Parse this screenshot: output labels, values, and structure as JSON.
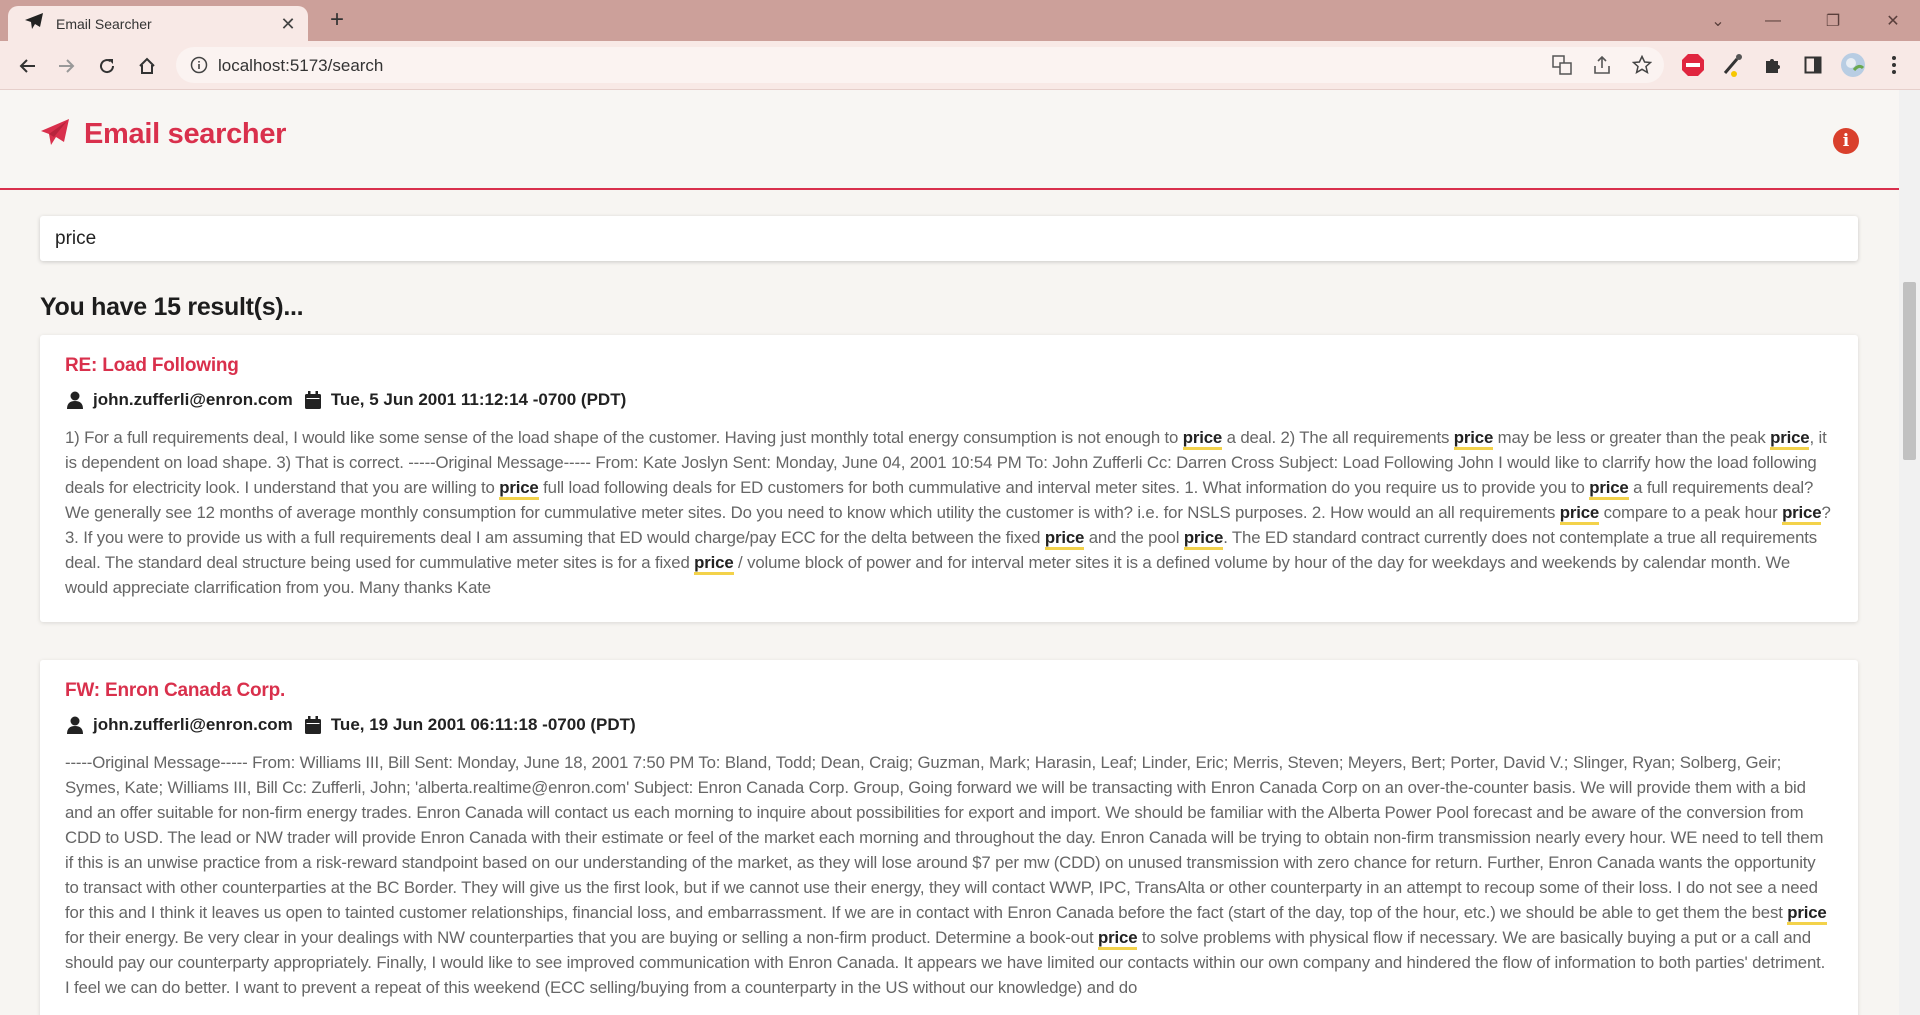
{
  "browser": {
    "tab_title": "Email Searcher",
    "url": "localhost:5173/search"
  },
  "app": {
    "title": "Email searcher",
    "info_label": "i"
  },
  "search": {
    "value": "price"
  },
  "results_heading": "You have 15 result(s)...",
  "results": [
    {
      "subject": "RE: Load Following",
      "from": "john.zufferli@enron.com",
      "date": "Tue, 5 Jun 2001 11:12:14 -0700 (PDT)",
      "body": "1) For a full requirements deal, I would like some sense of the load shape of the customer. Having just monthly total energy consumption is not enough to price a deal. 2) The all requirements price may be less or greater than the peak price, it is dependent on load shape. 3) That is correct. -----Original Message----- From: Kate Joslyn Sent: Monday, June 04, 2001 10:54 PM To: John Zufferli Cc: Darren Cross Subject: Load Following John I would like to clarrify how the load following deals for electricity look. I understand that you are willing to price full load following deals for ED customers for both cummulative and interval meter sites. 1. What information do you require us to provide you to price a full requirements deal? We generally see 12 months of average monthly consumption for cummulative meter sites. Do you need to know which utility the customer is with? i.e. for NSLS purposes. 2. How would an all requirements price compare to a peak hour price? 3. If you were to provide us with a full requirements deal I am assuming that ED would charge/pay ECC for the delta between the fixed price and the pool price. The ED standard contract currently does not contemplate a true all requirements deal. The standard deal structure being used for cummulative meter sites is for a fixed price / volume block of power and for interval meter sites it is a defined volume by hour of the day for weekdays and weekends by calendar month. We would appreciate clarrification from you. Many thanks Kate"
    },
    {
      "subject": "FW: Enron Canada Corp.",
      "from": "john.zufferli@enron.com",
      "date": "Tue, 19 Jun 2001 06:11:18 -0700 (PDT)",
      "body": "-----Original Message----- From: Williams III, Bill Sent: Monday, June 18, 2001 7:50 PM To: Bland, Todd; Dean, Craig; Guzman, Mark; Harasin, Leaf; Linder, Eric; Merris, Steven; Meyers, Bert; Porter, David V.; Slinger, Ryan; Solberg, Geir; Symes, Kate; Williams III, Bill Cc: Zufferli, John; 'alberta.realtime@enron.com' Subject: Enron Canada Corp. Group, Going forward we will be transacting with Enron Canada Corp on an over-the-counter basis. We will provide them with a bid and an offer suitable for non-firm energy trades. Enron Canada will contact us each morning to inquire about possibilities for export and import. We should be familiar with the Alberta Power Pool forecast and be aware of the conversion from CDD to USD. The lead or NW trader will provide Enron Canada with their estimate or feel of the market each morning and throughout the day. Enron Canada will be trying to obtain non-firm transmission nearly every hour. WE need to tell them if this is an unwise practice from a risk-reward standpoint based on our understanding of the market, as they will lose around $7 per mw (CDD) on unused transmission with zero chance for return. Further, Enron Canada wants the opportunity to transact with other counterparties at the BC Border. They will give us the first look, but if we cannot use their energy, they will contact WWP, IPC, TransAlta or other counterparty in an attempt to recoup some of their loss. I do not see a need for this and I think it leaves us open to tainted customer relationships, financial loss, and embarrassment. If we are in contact with Enron Canada before the fact (start of the day, top of the hour, etc.) we should be able to get them the best price for their energy. Be very clear in your dealings with NW counterparties that you are buying or selling a non-firm product. Determine a book-out price to solve problems with physical flow if necessary. We are basically buying a put or a call and should pay our counterparty appropriately. Finally, I would like to see improved communication with Enron Canada. It appears we have limited our contacts within our own company and hindered the flow of information to both parties' detriment. I feel we can do better. I want to prevent a repeat of this weekend (ECC selling/buying from a counterparty in the US without our knowledge) and do"
    }
  ],
  "colors": {
    "accent": "#d9304c",
    "highlight_underline": "#f3d24a",
    "tabbar": "#cca09a"
  }
}
